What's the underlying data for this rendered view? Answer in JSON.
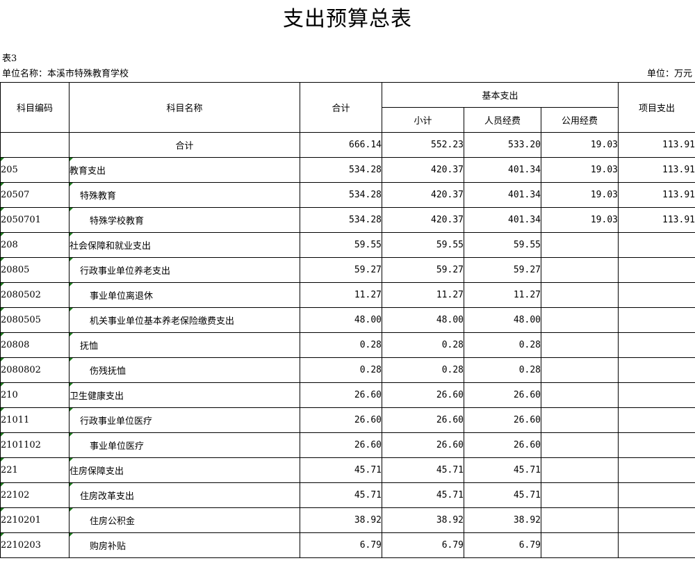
{
  "title": "支出预算总表",
  "table_label": "表3",
  "unit_name": "单位名称：本溪市特殊教育学校",
  "unit_measure": "单位：万元",
  "headers": {
    "code": "科目编码",
    "name": "科目名称",
    "total": "合计",
    "basic": "基本支出",
    "subtotal": "小计",
    "personnel": "人员经费",
    "public": "公用经费",
    "project": "项目支出"
  },
  "total_row": {
    "code": "",
    "name": "合计",
    "total": "666.14",
    "subtotal": "552.23",
    "personnel": "533.20",
    "public": "19.03",
    "project": "113.91"
  },
  "rows": [
    {
      "code": "205",
      "name": "教育支出",
      "level": 0,
      "total": "534.28",
      "subtotal": "420.37",
      "personnel": "401.34",
      "public": "19.03",
      "project": "113.91"
    },
    {
      "code": "20507",
      "name": "特殊教育",
      "level": 1,
      "total": "534.28",
      "subtotal": "420.37",
      "personnel": "401.34",
      "public": "19.03",
      "project": "113.91"
    },
    {
      "code": "2050701",
      "name": "特殊学校教育",
      "level": 2,
      "total": "534.28",
      "subtotal": "420.37",
      "personnel": "401.34",
      "public": "19.03",
      "project": "113.91"
    },
    {
      "code": "208",
      "name": "社会保障和就业支出",
      "level": 0,
      "total": "59.55",
      "subtotal": "59.55",
      "personnel": "59.55",
      "public": "",
      "project": ""
    },
    {
      "code": "20805",
      "name": "行政事业单位养老支出",
      "level": 1,
      "total": "59.27",
      "subtotal": "59.27",
      "personnel": "59.27",
      "public": "",
      "project": ""
    },
    {
      "code": "2080502",
      "name": "事业单位离退休",
      "level": 2,
      "total": "11.27",
      "subtotal": "11.27",
      "personnel": "11.27",
      "public": "",
      "project": ""
    },
    {
      "code": "2080505",
      "name": "机关事业单位基本养老保险缴费支出",
      "level": 2,
      "total": "48.00",
      "subtotal": "48.00",
      "personnel": "48.00",
      "public": "",
      "project": ""
    },
    {
      "code": "20808",
      "name": "抚恤",
      "level": 1,
      "total": "0.28",
      "subtotal": "0.28",
      "personnel": "0.28",
      "public": "",
      "project": ""
    },
    {
      "code": "2080802",
      "name": "伤残抚恤",
      "level": 2,
      "total": "0.28",
      "subtotal": "0.28",
      "personnel": "0.28",
      "public": "",
      "project": ""
    },
    {
      "code": "210",
      "name": "卫生健康支出",
      "level": 0,
      "total": "26.60",
      "subtotal": "26.60",
      "personnel": "26.60",
      "public": "",
      "project": ""
    },
    {
      "code": "21011",
      "name": "行政事业单位医疗",
      "level": 1,
      "total": "26.60",
      "subtotal": "26.60",
      "personnel": "26.60",
      "public": "",
      "project": ""
    },
    {
      "code": "2101102",
      "name": "事业单位医疗",
      "level": 2,
      "total": "26.60",
      "subtotal": "26.60",
      "personnel": "26.60",
      "public": "",
      "project": ""
    },
    {
      "code": "221",
      "name": "住房保障支出",
      "level": 0,
      "total": "45.71",
      "subtotal": "45.71",
      "personnel": "45.71",
      "public": "",
      "project": ""
    },
    {
      "code": "22102",
      "name": "住房改革支出",
      "level": 1,
      "total": "45.71",
      "subtotal": "45.71",
      "personnel": "45.71",
      "public": "",
      "project": ""
    },
    {
      "code": "2210201",
      "name": "住房公积金",
      "level": 2,
      "total": "38.92",
      "subtotal": "38.92",
      "personnel": "38.92",
      "public": "",
      "project": ""
    },
    {
      "code": "2210203",
      "name": "购房补贴",
      "level": 2,
      "total": "6.79",
      "subtotal": "6.79",
      "personnel": "6.79",
      "public": "",
      "project": ""
    }
  ]
}
